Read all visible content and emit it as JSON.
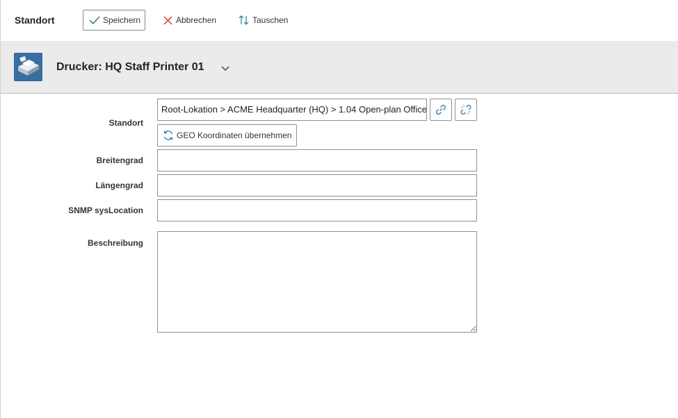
{
  "toolbar": {
    "title": "Standort",
    "save_label": "Speichern",
    "cancel_label": "Abbrechen",
    "swap_label": "Tauschen",
    "icons": {
      "save": "checkmark-icon",
      "cancel": "x-icon",
      "swap": "swap-arrows-icon"
    },
    "colors": {
      "save": "#2e8b3a",
      "cancel": "#d9302b",
      "swap": "#2e8b8b"
    }
  },
  "object_header": {
    "title": "Drucker: HQ Staff Printer 01",
    "icon": "printer-icon",
    "menu_icon": "chevron-down-icon"
  },
  "form": {
    "standort": {
      "label": "Standort",
      "value": "Root-Lokation > ACME Headquarter (HQ) > 1.04 Open-plan Office",
      "link_icon": "link-icon",
      "unlink_icon": "unlink-icon",
      "geo_button_label": "GEO Koordinaten übernehmen",
      "geo_icon": "refresh-icon"
    },
    "breitengrad": {
      "label": "Breitengrad",
      "value": ""
    },
    "laengengrad": {
      "label": "Längengrad",
      "value": ""
    },
    "snmp": {
      "label": "SNMP sysLocation",
      "value": ""
    },
    "beschreibung": {
      "label": "Beschreibung",
      "value": ""
    }
  }
}
